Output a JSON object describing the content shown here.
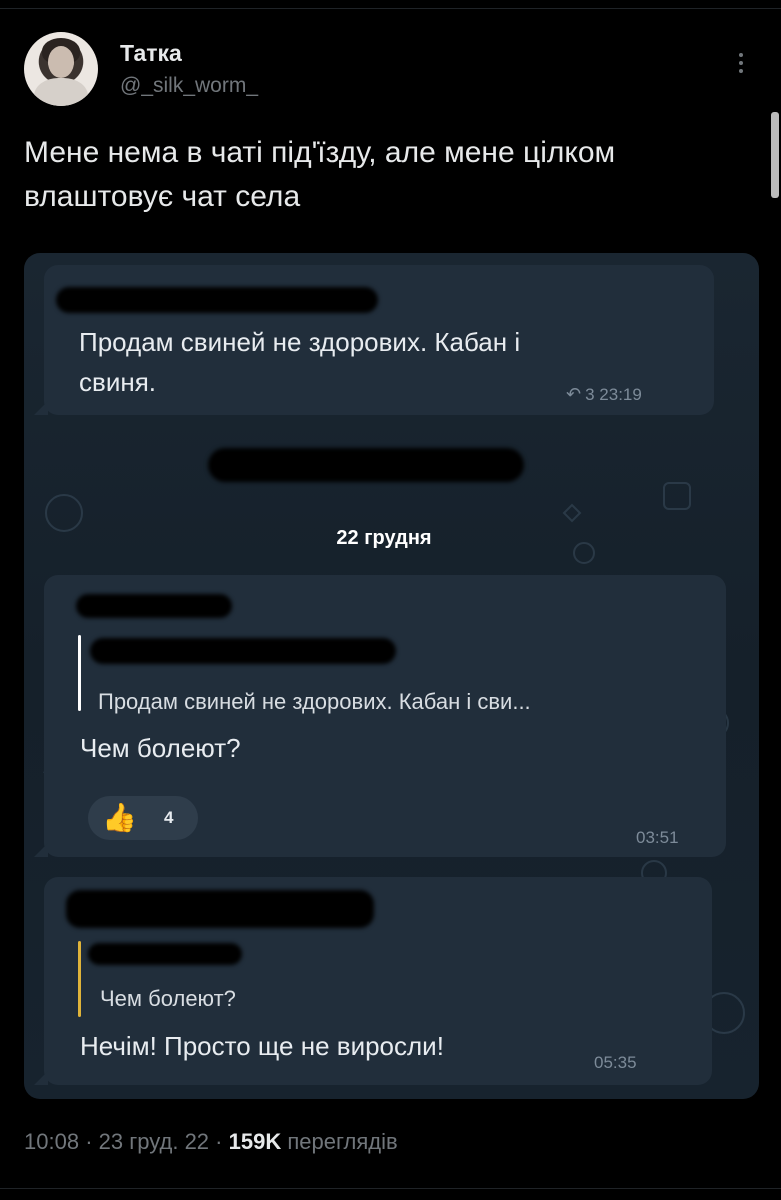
{
  "author": {
    "name": "Татка",
    "handle": "@_silk_worm_"
  },
  "tweet": {
    "text": "Мене нема в чаті під'їзду, але мене цілком влаштовує чат села"
  },
  "screenshot": {
    "message1": {
      "text_line1": "Продам свиней не здорових. Кабан і",
      "text_line2": "свиня.",
      "replies": "3",
      "time": "23:19",
      "reply_icon": "reply-arrow-icon"
    },
    "date_separator": "22 грудня",
    "message2": {
      "quote": "Продам свиней не здорових. Кабан і сви...",
      "text": "Чем болеют?",
      "reaction_count": "4",
      "reaction_icon": "thumbs-up-icon",
      "time": "03:51"
    },
    "message3": {
      "quote": "Чем болеют?",
      "text": "Нечім! Просто ще не виросли!",
      "time": "05:35"
    }
  },
  "meta": {
    "time": "10:08",
    "date": "23 груд. 22",
    "views_count": "159K",
    "views_label": "переглядів",
    "separator": "·"
  },
  "colors": {
    "background": "#000000",
    "chat_bg": "#17232e",
    "bubble": "#212e3b",
    "quote_bar_white": "#ffffff",
    "quote_bar_yellow": "#e0b43a"
  }
}
